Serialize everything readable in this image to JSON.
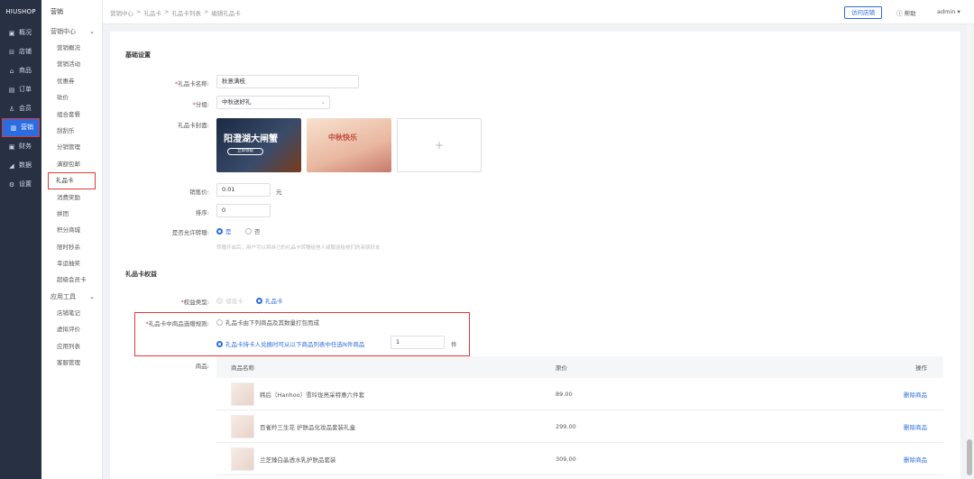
{
  "brand": "HIUSHOP",
  "nav": [
    {
      "icon": "▣",
      "label": "概况"
    },
    {
      "icon": "⊟",
      "label": "店铺"
    },
    {
      "icon": "⌂",
      "label": "商品"
    },
    {
      "icon": "▤",
      "label": "订单"
    },
    {
      "icon": "♙",
      "label": "会员"
    },
    {
      "icon": "▥",
      "label": "营销"
    },
    {
      "icon": "▣",
      "label": "财务"
    },
    {
      "icon": "◢",
      "label": "数据"
    },
    {
      "icon": "⚙",
      "label": "设置"
    }
  ],
  "subnav": {
    "title": "营销",
    "group1": "营销中心",
    "items": [
      "营销概况",
      "营销活动",
      "优惠券",
      "砍价",
      "组合套餐",
      "刮刮乐",
      "分销管理",
      "满额包邮",
      "礼品卡",
      "消费奖励",
      "拼团",
      "积分商城",
      "限时秒杀",
      "幸运抽奖",
      "超级会员卡"
    ],
    "group2": "应用工具",
    "items2": [
      "店铺笔记",
      "虚拟评价",
      "应用列表",
      "客服管理"
    ]
  },
  "breadcrumb": [
    "营销中心",
    ">",
    "礼品卡",
    ">",
    "礼品卡列表",
    ">",
    "编辑礼品卡"
  ],
  "topbar": {
    "visit": "访问店铺",
    "help": "帮助",
    "user": "admin"
  },
  "basic": {
    "section": "基础设置",
    "name_label": "礼品卡名称:",
    "name_value": "秋意满枝",
    "group_label": "分组:",
    "group_value": "中秋送好礼",
    "cover_label": "礼品卡封面:",
    "cover1_text": "阳澄湖大闸蟹",
    "cover1_btn": "立即领取",
    "cover2_text": "中秋快乐",
    "cover_add": "+",
    "price_label": "销售价:",
    "price_value": "0.01",
    "price_unit": "元",
    "sort_label": "排序:",
    "sort_value": "0",
    "transfer_label": "是否允许转赠:",
    "yes": "是",
    "no": "否",
    "hint": "转赠开启后，用户可以将自己的礼品卡转赠给他人或赠送给他们的亲朋好友"
  },
  "rights": {
    "section": "礼品卡权益",
    "type_label": "权益类型:",
    "opt_disabled": "储值卡",
    "opt_gift": "礼品卡",
    "rule_label": "礼品卡中商品选赠规则:",
    "rule1": "礼品卡由下列商品及其数量打包而成",
    "rule2": "礼品卡持卡人兑换时可从以下商品列表中任选N件商品",
    "qty": "1",
    "qty_unit": "件",
    "goods_label": "商品:"
  },
  "table": {
    "headers": [
      "商品名称",
      "原价",
      "操作"
    ],
    "rows": [
      {
        "name": "韩后（Hanhoo）雪玲珑亮采特惠六件套",
        "price": "89.00",
        "action": "删除商品"
      },
      {
        "name": "百雀羚三生花 护肤品化妆品套装礼盒",
        "price": "299.00",
        "action": "删除商品"
      },
      {
        "name": "兰芝臻白晶透水乳护肤品套装",
        "price": "309.00",
        "action": "删除商品"
      }
    ]
  }
}
